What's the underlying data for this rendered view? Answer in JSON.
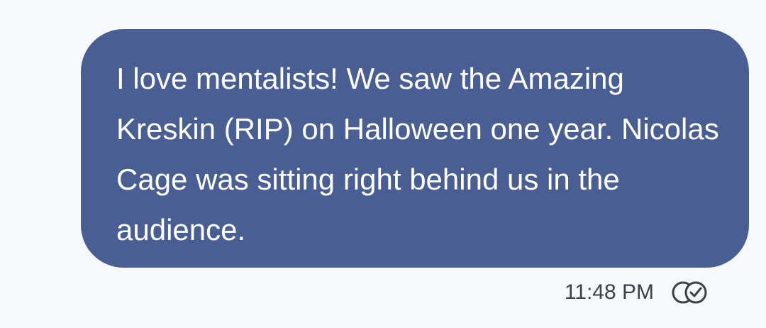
{
  "message": {
    "text": "I love mentalists! We saw the Amazing Kreskin (RIP) on Halloween one year. Nicolas Cage was sitting right behind us in the audience.",
    "timestamp": "11:48 PM",
    "status_icon": "delivered-read-icon"
  },
  "colors": {
    "background": "#f7f8fc",
    "bubble": "#495e93",
    "bubble_text": "#ffffff",
    "meta_text": "#3c3f46"
  }
}
